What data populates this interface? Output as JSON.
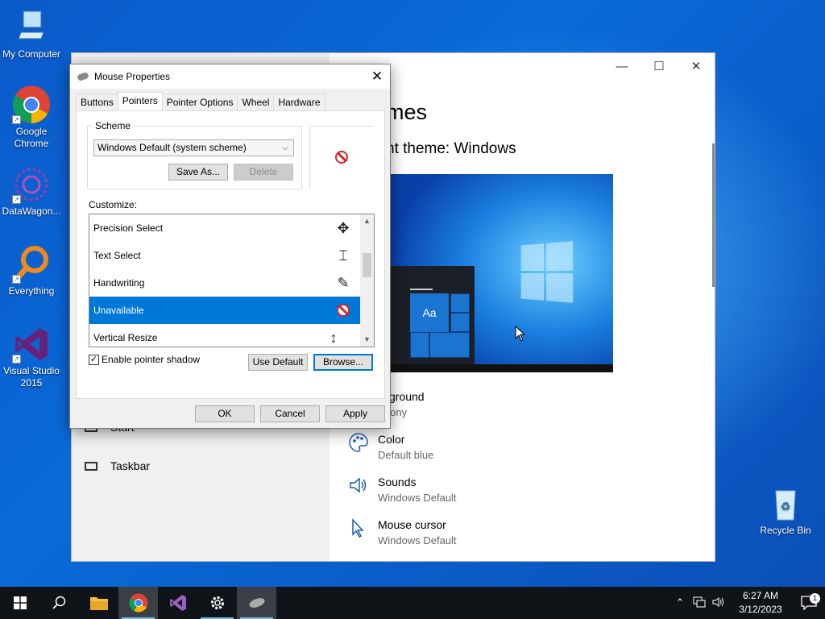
{
  "desktop": {
    "icons": [
      {
        "label": "My Computer"
      },
      {
        "label": "Google Chrome"
      },
      {
        "label": "DataWagon..."
      },
      {
        "label": "Everything"
      },
      {
        "label": "Visual Studio 2015"
      },
      {
        "label": "Recycle Bin"
      }
    ]
  },
  "settings": {
    "page_title": "mes",
    "theme_title": "nt theme: Windows",
    "preview_tile_text": "Aa",
    "items": [
      {
        "title": "ckground",
        "value": "rmony",
        "icon": "image-icon"
      },
      {
        "title": "Color",
        "value": "Default blue",
        "icon": "palette-icon"
      },
      {
        "title": "Sounds",
        "value": "Windows Default",
        "icon": "speaker-icon"
      },
      {
        "title": "Mouse cursor",
        "value": "Windows Default",
        "icon": "cursor-icon"
      }
    ],
    "left_items": [
      {
        "label": "Start"
      },
      {
        "label": "Taskbar"
      }
    ],
    "controls": {
      "minimize": "—",
      "maximize": "☐",
      "close": "✕"
    }
  },
  "dialog": {
    "title": "Mouse Properties",
    "close": "✕",
    "tabs": [
      "Buttons",
      "Pointers",
      "Pointer Options",
      "Wheel",
      "Hardware"
    ],
    "active_tab": "Pointers",
    "scheme": {
      "legend": "Scheme",
      "selected": "Windows Default (system scheme)",
      "save_as": "Save As...",
      "delete": "Delete"
    },
    "customize_label": "Customize:",
    "pointer_list": [
      {
        "name": "Precision Select",
        "cursor": "✥",
        "selected": false
      },
      {
        "name": "Text Select",
        "cursor": "⌶",
        "selected": false
      },
      {
        "name": "Handwriting",
        "cursor": "✎",
        "selected": false
      },
      {
        "name": "Unavailable",
        "cursor": "no-entry",
        "selected": true
      },
      {
        "name": "Vertical Resize",
        "cursor": "↕",
        "selected": false
      }
    ],
    "enable_shadow": {
      "label": "Enable pointer shadow",
      "checked": true
    },
    "use_default": "Use Default",
    "browse": "Browse...",
    "ok": "OK",
    "cancel": "Cancel",
    "apply": "Apply"
  },
  "taskbar": {
    "clock_time": "6:27 AM",
    "clock_date": "3/12/2023",
    "notification_count": "1"
  }
}
